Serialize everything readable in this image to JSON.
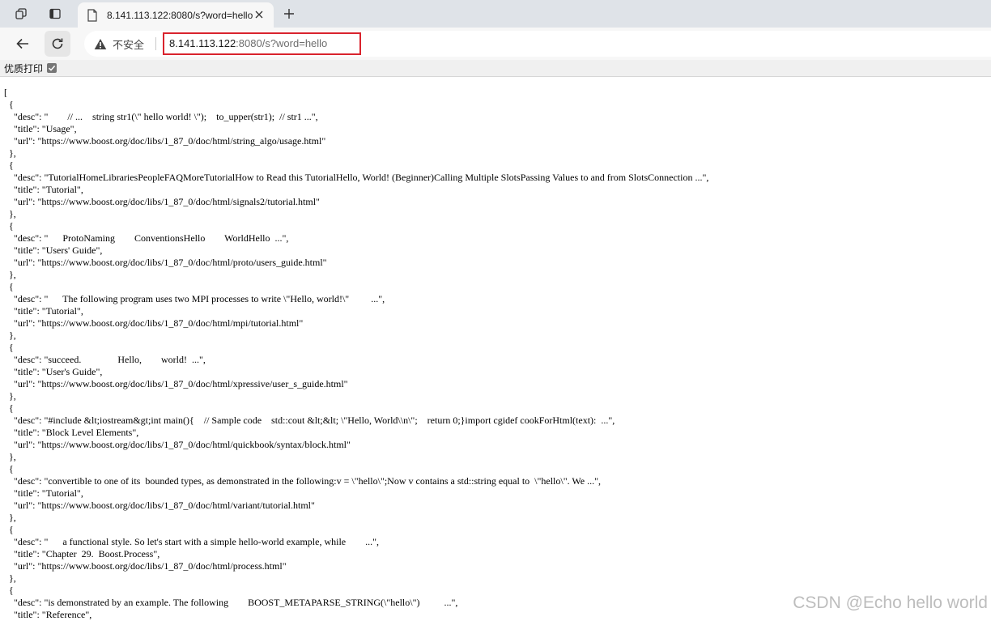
{
  "browser": {
    "tab": {
      "title": "8.141.113.122:8080/s?word=hello"
    },
    "address_bar": {
      "security_label": "不安全",
      "url_host": "8.141.113.122",
      "url_rest": ":8080/s?word=hello"
    },
    "pretty_print": {
      "label": "优质打印",
      "checked": true
    }
  },
  "json_view": {
    "lines": [
      "[",
      "  {",
      "    \"desc\": \"        // ...    string str1(\\\" hello world! \\\");    to_upper(str1);  // str1 ...\",",
      "    \"title\": \"Usage\",",
      "    \"url\": \"https://www.boost.org/doc/libs/1_87_0/doc/html/string_algo/usage.html\"",
      "  },",
      "  {",
      "    \"desc\": \"TutorialHomeLibrariesPeopleFAQMoreTutorialHow to Read this TutorialHello, World! (Beginner)Calling Multiple SlotsPassing Values to and from SlotsConnection ...\",",
      "    \"title\": \"Tutorial\",",
      "    \"url\": \"https://www.boost.org/doc/libs/1_87_0/doc/html/signals2/tutorial.html\"",
      "  },",
      "  {",
      "    \"desc\": \"      ProtoNaming        ConventionsHello        WorldHello  ...\",",
      "    \"title\": \"Users' Guide\",",
      "    \"url\": \"https://www.boost.org/doc/libs/1_87_0/doc/html/proto/users_guide.html\"",
      "  },",
      "  {",
      "    \"desc\": \"      The following program uses two MPI processes to write \\\"Hello, world!\\\"         ...\",",
      "    \"title\": \"Tutorial\",",
      "    \"url\": \"https://www.boost.org/doc/libs/1_87_0/doc/html/mpi/tutorial.html\"",
      "  },",
      "  {",
      "    \"desc\": \"succeed.               Hello,        world!  ...\",",
      "    \"title\": \"User's Guide\",",
      "    \"url\": \"https://www.boost.org/doc/libs/1_87_0/doc/html/xpressive/user_s_guide.html\"",
      "  },",
      "  {",
      "    \"desc\": \"#include &lt;iostream&gt;int main(){    // Sample code    std::cout &lt;&lt; \\\"Hello, World\\\\n\\\";    return 0;}import cgidef cookForHtml(text):  ...\",",
      "    \"title\": \"Block Level Elements\",",
      "    \"url\": \"https://www.boost.org/doc/libs/1_87_0/doc/html/quickbook/syntax/block.html\"",
      "  },",
      "  {",
      "    \"desc\": \"convertible to one of its  bounded types, as demonstrated in the following:v = \\\"hello\\\";Now v contains a std::string equal to  \\\"hello\\\". We ...\",",
      "    \"title\": \"Tutorial\",",
      "    \"url\": \"https://www.boost.org/doc/libs/1_87_0/doc/html/variant/tutorial.html\"",
      "  },",
      "  {",
      "    \"desc\": \"      a functional style. So let's start with a simple hello-world example, while        ...\",",
      "    \"title\": \"Chapter  29.  Boost.Process\",",
      "    \"url\": \"https://www.boost.org/doc/libs/1_87_0/doc/html/process.html\"",
      "  },",
      "  {",
      "    \"desc\": \"is demonstrated by an example. The following        BOOST_METAPARSE_STRING(\\\"hello\\\")          ...\",",
      "    \"title\": \"Reference\","
    ]
  },
  "watermark": "CSDN @Echo hello world"
}
